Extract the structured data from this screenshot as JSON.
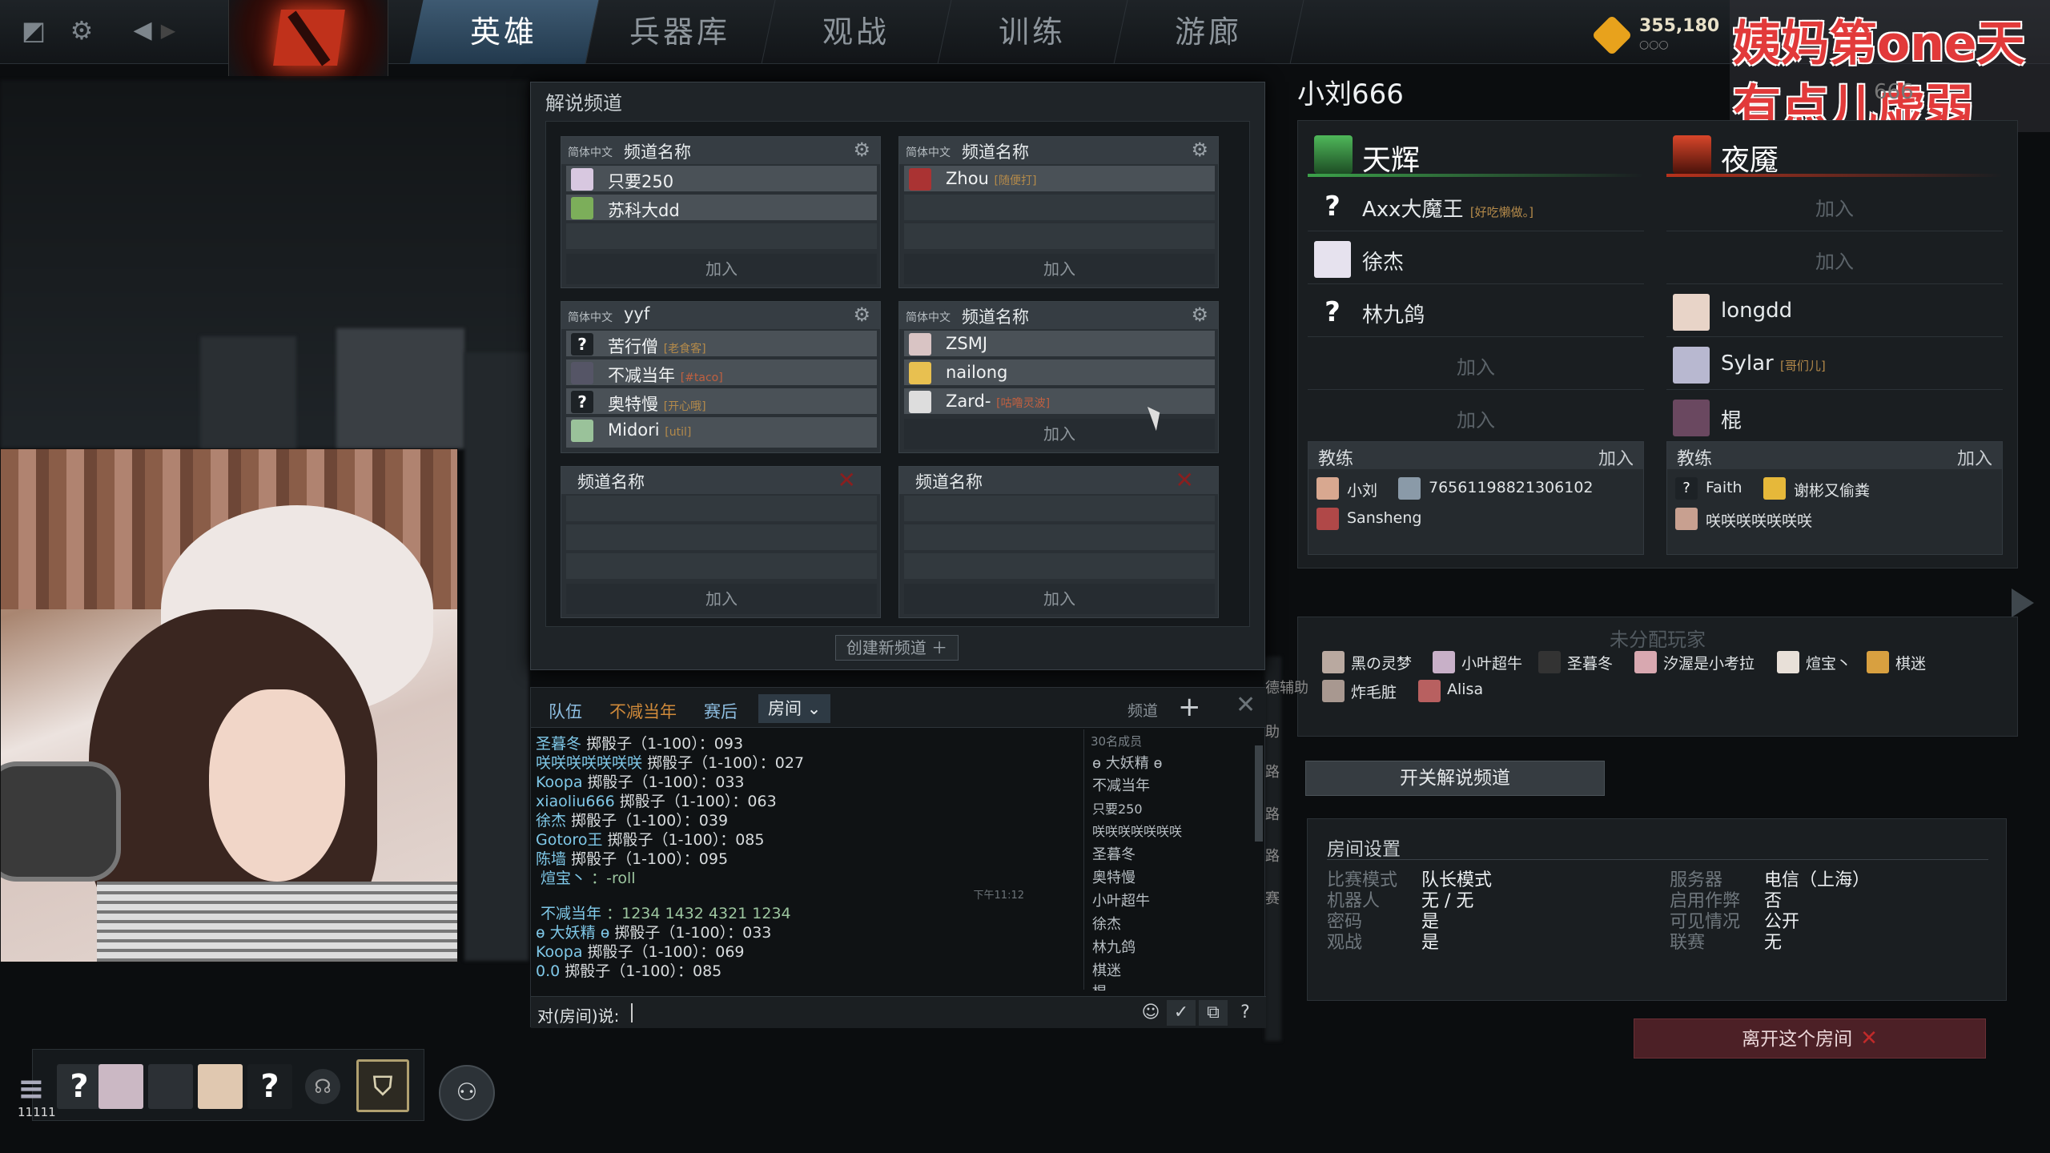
{
  "nav": {
    "tabs": [
      "英雄",
      "兵器库",
      "观战",
      "训练",
      "游廊"
    ],
    "active_tab": "英雄",
    "gold": "355,180",
    "gold_sub": "○○○"
  },
  "overlay_text": {
    "line1": "姨妈第one天",
    "line2": "有点儿虚弱"
  },
  "broadcast": {
    "title": "解说频道",
    "create_label": "创建新频道 ＋",
    "channels": [
      {
        "lang": "简体中文",
        "name": "频道名称",
        "players": [
          {
            "name": "只要250",
            "tag": ""
          },
          {
            "name": "苏科大dd",
            "tag": ""
          }
        ],
        "join": "加入"
      },
      {
        "lang": "简体中文",
        "name": "频道名称",
        "players": [
          {
            "name": "Zhou",
            "tag": "[随便打]"
          }
        ],
        "join": "加入"
      },
      {
        "lang": "简体中文",
        "name": "yyf",
        "players": [
          {
            "name": "苦行僧",
            "tag": "[老食客]"
          },
          {
            "name": "不减当年",
            "tag": "[#taco]"
          },
          {
            "name": "奥特慢",
            "tag": "[开心哦]"
          },
          {
            "name": "Midori",
            "tag": "[util]"
          }
        ],
        "join": ""
      },
      {
        "lang": "简体中文",
        "name": "频道名称",
        "players": [
          {
            "name": "ZSMJ",
            "tag": ""
          },
          {
            "name": "nailong",
            "tag": ""
          },
          {
            "name": "Zard-",
            "tag": "[咕噜灵波]"
          }
        ],
        "join": "加入"
      },
      {
        "lang": "",
        "name": "频道名称",
        "players": [],
        "join": "加入"
      },
      {
        "lang": "",
        "name": "频道名称",
        "players": [],
        "join": "加入"
      }
    ]
  },
  "lobby": {
    "title": "小刘666",
    "subtitle": "666",
    "radiant": {
      "name": "天辉",
      "slots": [
        {
          "name": "Axx大魔王",
          "tag": "[好吃懒做。]",
          "avatar": "?"
        },
        {
          "name": "徐杰",
          "tag": "",
          "avatar": ""
        },
        {
          "name": "林九鸽",
          "tag": "",
          "avatar": "?"
        },
        {
          "name": "",
          "join": "加入"
        },
        {
          "name": "",
          "join": "加入"
        }
      ],
      "coach_label": "教练",
      "coach_join": "加入",
      "coaches": [
        "小刘",
        "76561198821306102",
        "Sansheng"
      ]
    },
    "dire": {
      "name": "夜魇",
      "slots": [
        {
          "name": "",
          "join": "加入"
        },
        {
          "name": "",
          "join": "加入"
        },
        {
          "name": "longdd",
          "tag": "",
          "avatar": ""
        },
        {
          "name": "Sylar",
          "tag": "[哥们儿]",
          "avatar": ""
        },
        {
          "name": "棍",
          "tag": "",
          "avatar": ""
        }
      ],
      "coach_label": "教练",
      "coach_join": "加入",
      "coaches": [
        "Faith",
        "谢彬又偷粪",
        "咲咲咲咲咲咲咲"
      ]
    },
    "unassigned_title": "未分配玩家",
    "unassigned": [
      "黑の灵梦",
      "小叶超牛",
      "圣暮冬",
      "汐渥是小考拉",
      "煊宝丶",
      "棋迷",
      "炸毛脏",
      "Alisa"
    ],
    "toggle_broadcast": "开关解说频道",
    "leave": "离开这个房间"
  },
  "room_settings": {
    "title": "房间设置",
    "left": [
      {
        "k": "比赛模式",
        "v": "队长模式"
      },
      {
        "k": "机器人",
        "v": "无 / 无"
      },
      {
        "k": "密码",
        "v": "是"
      },
      {
        "k": "观战",
        "v": "是"
      }
    ],
    "right": [
      {
        "k": "服务器",
        "v": "电信（上海）"
      },
      {
        "k": "启用作弊",
        "v": "否"
      },
      {
        "k": "可见情况",
        "v": "公开"
      },
      {
        "k": "联赛",
        "v": "无"
      }
    ]
  },
  "chat": {
    "tabs": [
      "队伍",
      "不减当年",
      "赛后",
      "房间"
    ],
    "channel_label": "频道",
    "members_header": "30名成员",
    "members": [
      "ɵ 大妖精 ɵ",
      "不减当年",
      "只要250",
      "咲咲咲咲咲咲咲",
      "圣暮冬",
      "奥特慢",
      "小叶超牛",
      "徐杰",
      "林九鸽",
      "棋迷",
      "棍"
    ],
    "time": "下午11:12",
    "messages": [
      {
        "who": "圣暮冬",
        "text": "掷骰子（1-100）：093"
      },
      {
        "who": "咲咲咲咲咲咲咲",
        "text": "掷骰子（1-100）：027"
      },
      {
        "who": "Koopa",
        "text": "掷骰子（1-100）：033"
      },
      {
        "who": "xiaoliu666",
        "text": "掷骰子（1-100）：063"
      },
      {
        "who": "徐杰",
        "text": "掷骰子（1-100）：039"
      },
      {
        "who": "Gotoro王",
        "text": "掷骰子（1-100）：085"
      },
      {
        "who": "陈墙",
        "text": "掷骰子（1-100）：095"
      },
      {
        "who": "煊宝丶",
        "text": "：-roll"
      },
      {
        "who": "不减当年",
        "text": "：1234 1432 4321 1234"
      },
      {
        "who": "ɵ 大妖精 ɵ",
        "text": "掷骰子（1-100）：033"
      },
      {
        "who": "Koopa",
        "text": "掷骰子（1-100）：069"
      },
      {
        "who": "0.0",
        "text": "掷骰子（1-100）：085"
      }
    ],
    "input_label": "对(房间)说:",
    "side_labels": [
      "德辅助",
      "助",
      "路",
      "路",
      "路",
      "赛"
    ]
  },
  "bottom": {
    "wm": "11111"
  }
}
